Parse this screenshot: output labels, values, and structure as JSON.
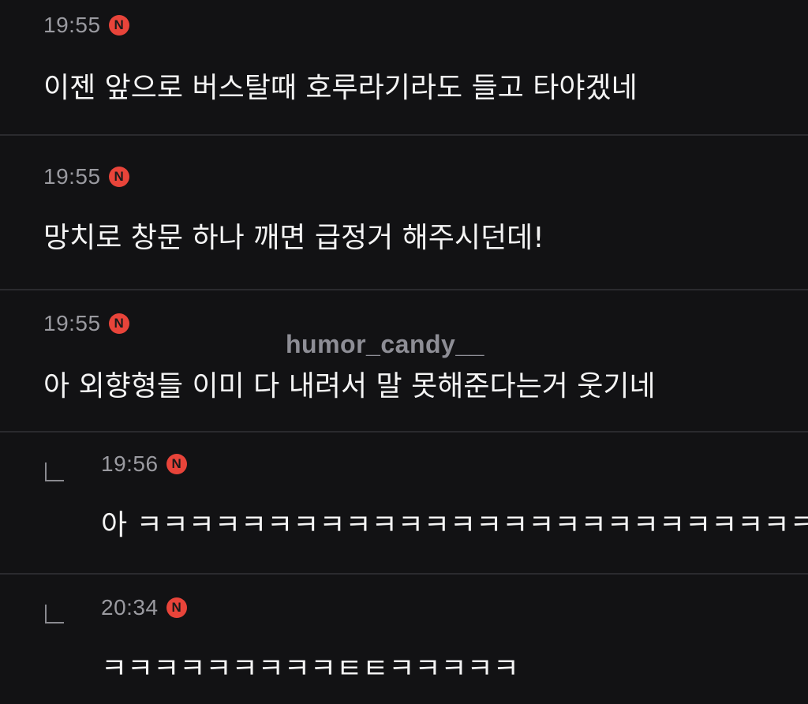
{
  "badge_letter": "N",
  "badge_color": "#e8443a",
  "watermark": "humor_candy__",
  "comments": [
    {
      "time": "19:55",
      "text": "이젠 앞으로 버스탈때 호루라기라도 들고 타야겠네",
      "is_reply": false
    },
    {
      "time": "19:55",
      "text": "망치로 창문 하나 깨면 급정거 해주시던데!",
      "is_reply": false
    },
    {
      "time": "19:55",
      "text": "아 외향형들 이미 다 내려서 말 못해준다는거 웃기네",
      "is_reply": false
    },
    {
      "time": "19:56",
      "text": "아 ㅋㅋㅋㅋㅋㅋㅋㅋㅋㅋㅋㅋㅋㅋㅋㅋㅋㅋㅋㅋㅋㅋㅋㅋㅋㅋㅋ",
      "is_reply": true
    },
    {
      "time": "20:34",
      "text": "ㅋㅋㅋㅋㅋㅋㅋㅋㅋㅌㅌㅋㅋㅋㅋㅋ",
      "is_reply": true
    }
  ]
}
